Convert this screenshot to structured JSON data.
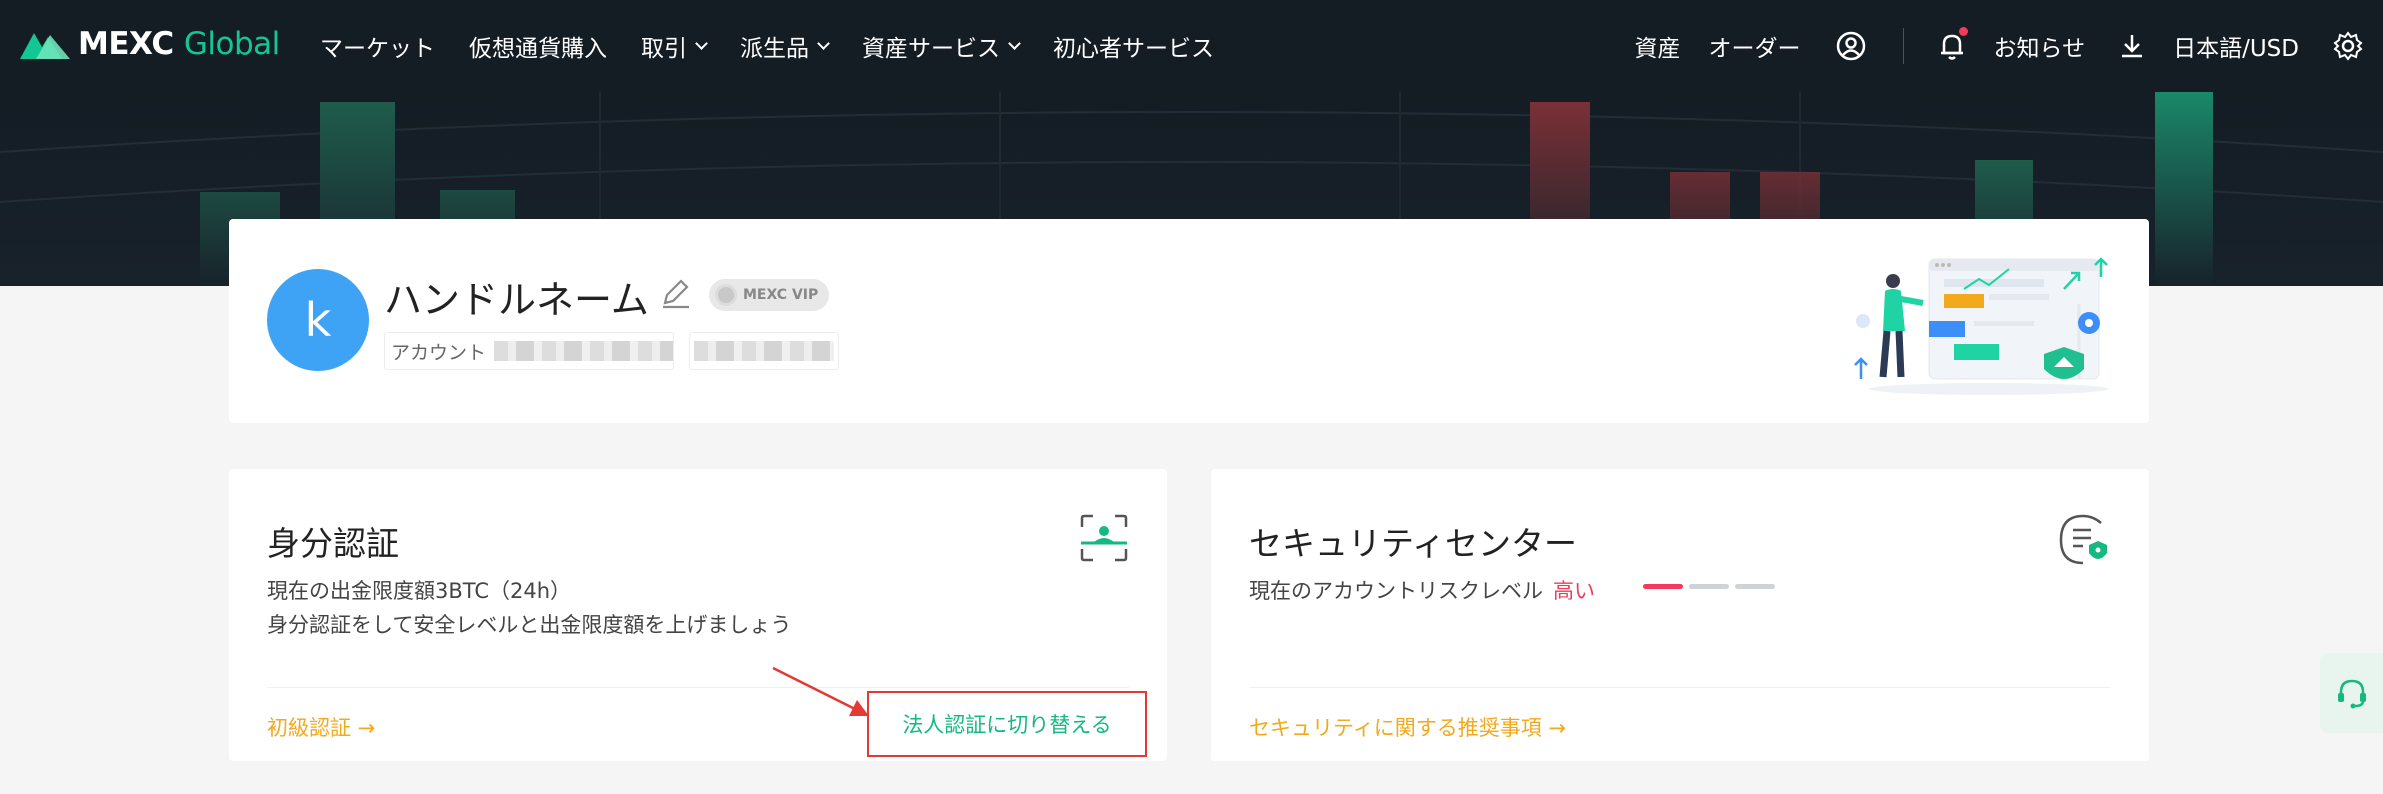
{
  "header": {
    "logo_text_1": "MEXC",
    "logo_text_2": "Global",
    "nav": [
      {
        "label": "マーケット",
        "dropdown": false
      },
      {
        "label": "仮想通貨購入",
        "dropdown": false
      },
      {
        "label": "取引",
        "dropdown": true
      },
      {
        "label": "派生品",
        "dropdown": true
      },
      {
        "label": "資産サービス",
        "dropdown": true
      },
      {
        "label": "初心者サービス",
        "dropdown": false
      }
    ],
    "assets": "資産",
    "orders": "オーダー",
    "notifications": "お知らせ",
    "language": "日本語/USD"
  },
  "profile": {
    "avatar_letter": "k",
    "username": "ハンドルネーム",
    "vip_label": "MEXC VIP",
    "account_label": "アカウント"
  },
  "identity_card": {
    "title": "身分認証",
    "limit_text": "現在の出金限度額3BTC（24h）",
    "description": "身分認証をして安全レベルと出金限度額を上げましょう",
    "primary_link": "初級認証 →",
    "switch_link": "法人認証に切り替える"
  },
  "security_card": {
    "title": "セキュリティセンター",
    "risk_label": "現在のアカウントリスクレベル",
    "risk_level": "高い",
    "link": "セキュリティに関する推奨事項 →"
  },
  "colors": {
    "brand": "#13c795",
    "header_bg": "#141c24",
    "link_orange": "#f2a91c",
    "risk_red": "#f23a5a",
    "avatar_blue": "#3ea3f5",
    "highlight_red": "#e53935"
  },
  "icons": [
    "mexc-logo-icon",
    "user-circle-icon",
    "bell-icon",
    "download-icon",
    "gear-icon",
    "edit-icon",
    "face-scan-icon",
    "security-shield-icon",
    "support-headset-icon"
  ]
}
